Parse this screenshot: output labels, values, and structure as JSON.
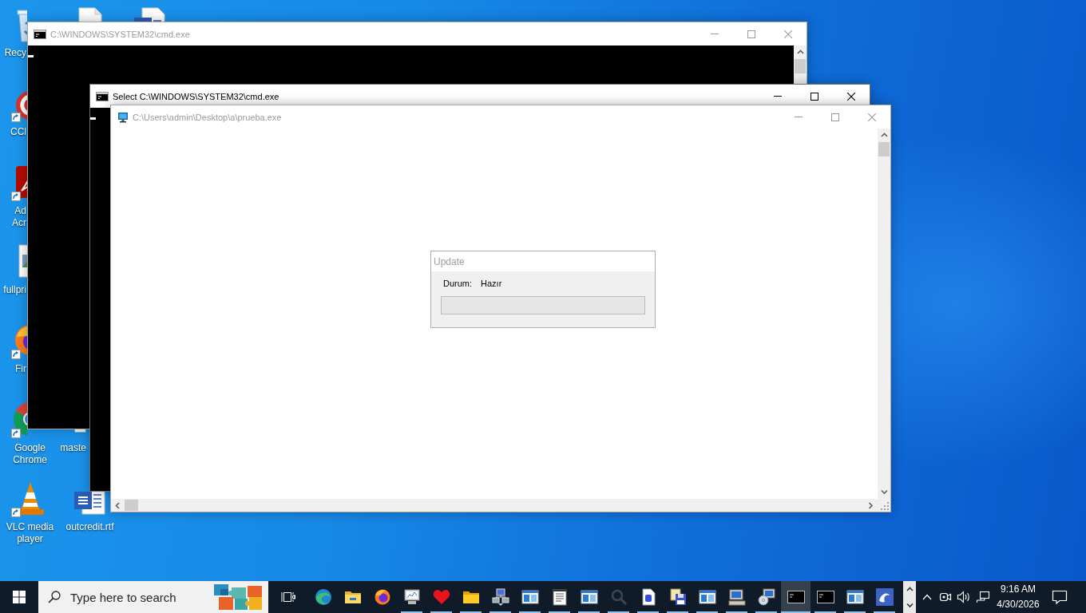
{
  "desktop": {
    "icons": [
      {
        "kind": "bin",
        "label": "Recy",
        "shortcut": false
      },
      {
        "kind": "cleaner",
        "label": "CCl",
        "shortcut": true
      },
      {
        "kind": "acrobat",
        "label": "Ad Acr",
        "shortcut": true
      },
      {
        "kind": "picture",
        "label": "fullpri",
        "shortcut": false
      },
      {
        "kind": "firefox",
        "label": "Fir",
        "shortcut": true
      },
      {
        "kind": "chrome",
        "label": "Google Chrome",
        "shortcut": true
      },
      {
        "kind": "vlc",
        "label": "VLC media player",
        "shortcut": true
      },
      {
        "kind": "file",
        "shortcut": false
      },
      {
        "kind": "file",
        "label": "maste",
        "shortcut": false
      },
      {
        "kind": "word",
        "label": "outcredit.rtf",
        "shortcut": false
      },
      {
        "kind": "word",
        "shortcut": false
      }
    ]
  },
  "windows": [
    {
      "kind": "console",
      "title": "C:\\WINDOWS\\SYSTEM32\\cmd.exe",
      "active": false
    },
    {
      "kind": "console",
      "title": "Select C:\\WINDOWS\\SYSTEM32\\cmd.exe",
      "active": true
    },
    {
      "kind": "form",
      "title": "C:\\Users\\admin\\Desktop\\a\\prueba.exe",
      "active": false,
      "group": {
        "title": "Update",
        "label": "Durum:",
        "value": "Hazır",
        "level": 0
      }
    }
  ],
  "taskbar": {
    "search": {
      "placeholder": "Type here to search"
    },
    "apps": [
      {
        "kind": "edge",
        "running": false,
        "active": false
      },
      {
        "kind": "explorer",
        "running": false,
        "active": false
      },
      {
        "kind": "firefox",
        "running": false,
        "active": false
      },
      {
        "kind": "monitor",
        "running": true,
        "active": false
      },
      {
        "kind": "heart",
        "running": true,
        "active": false
      },
      {
        "kind": "folder",
        "running": true,
        "active": false
      },
      {
        "kind": "network",
        "running": true,
        "active": false
      },
      {
        "kind": "window",
        "running": true,
        "active": false
      },
      {
        "kind": "notepad",
        "running": true,
        "active": false
      },
      {
        "kind": "window",
        "running": true,
        "active": false
      },
      {
        "kind": "magnifier",
        "running": true,
        "active": false
      },
      {
        "kind": "document",
        "running": true,
        "active": false
      },
      {
        "kind": "floppy",
        "running": true,
        "active": false
      },
      {
        "kind": "window",
        "running": true,
        "active": false
      },
      {
        "kind": "computer",
        "running": true,
        "active": false
      },
      {
        "kind": "setup",
        "running": true,
        "active": false
      },
      {
        "kind": "console",
        "running": true,
        "active": true
      },
      {
        "kind": "console",
        "running": true,
        "active": false
      },
      {
        "kind": "window",
        "running": true,
        "active": false
      },
      {
        "kind": "wave",
        "running": true,
        "active": false
      }
    ],
    "clock": {
      "time": "9:16 AM",
      "date": "4/30/2026"
    }
  }
}
